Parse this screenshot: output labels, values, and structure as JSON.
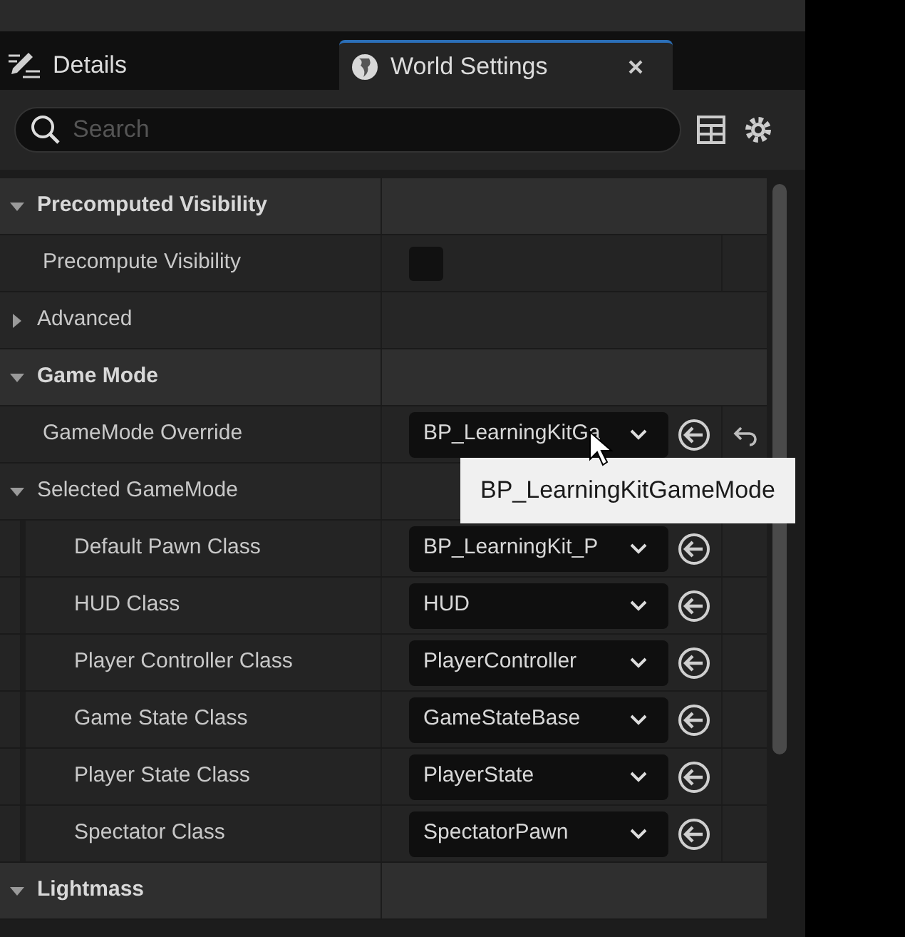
{
  "tabs": [
    {
      "label": "Details",
      "selected": false,
      "closable": false
    },
    {
      "label": "World Settings",
      "selected": true,
      "closable": true
    }
  ],
  "search": {
    "placeholder": "Search"
  },
  "tree": [
    {
      "kind": "category",
      "label": "Precomputed Visibility",
      "expanded": true,
      "children": [
        {
          "kind": "checkbox",
          "label": "Precompute Visibility",
          "checked": false
        }
      ]
    },
    {
      "kind": "group",
      "label": "Advanced",
      "expanded": false
    },
    {
      "kind": "category",
      "label": "Game Mode",
      "expanded": true,
      "children": [
        {
          "kind": "dropdown",
          "label": "GameMode Override",
          "value": "BP_LearningKitGa",
          "modified": true
        },
        {
          "kind": "group",
          "label": "Selected GameMode",
          "expanded": true,
          "children": [
            {
              "kind": "dropdown",
              "label": "Default Pawn Class",
              "value": "BP_LearningKit_P",
              "modified": false
            },
            {
              "kind": "dropdown",
              "label": "HUD Class",
              "value": "HUD",
              "modified": false
            },
            {
              "kind": "dropdown",
              "label": "Player Controller Class",
              "value": "PlayerController",
              "modified": false
            },
            {
              "kind": "dropdown",
              "label": "Game State Class",
              "value": "GameStateBase",
              "modified": false
            },
            {
              "kind": "dropdown",
              "label": "Player State Class",
              "value": "PlayerState",
              "modified": false
            },
            {
              "kind": "dropdown",
              "label": "Spectator Class",
              "value": "SpectatorPawn",
              "modified": false
            }
          ]
        }
      ]
    },
    {
      "kind": "category",
      "label": "Lightmass",
      "expanded": true
    }
  ],
  "tooltip": "BP_LearningKitGameMode"
}
